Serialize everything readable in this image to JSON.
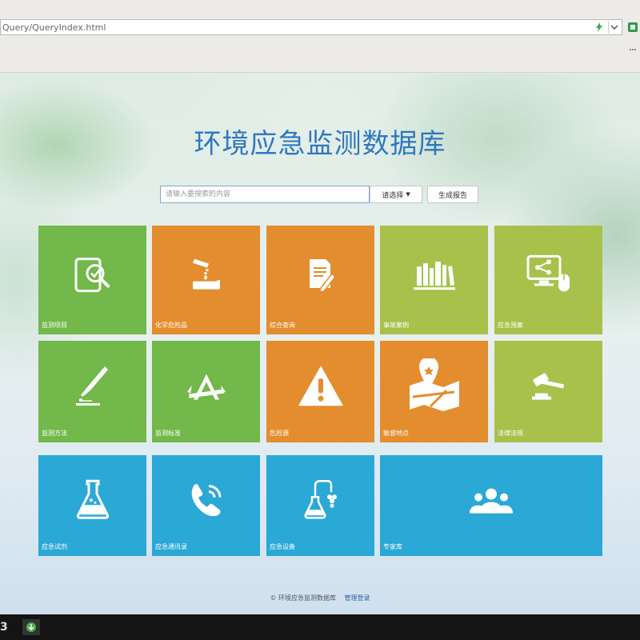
{
  "browser": {
    "url": "Query/QueryIndex.html",
    "icons": [
      "lightning-icon",
      "dropdown-icon",
      "extension-icon"
    ]
  },
  "page": {
    "title": "环境应急监测数据库",
    "search": {
      "placeholder": "请输入要搜索的内容",
      "select_label": "请选择",
      "report_label": "生成报告"
    },
    "tiles": [
      {
        "label": "监测项目",
        "color": "#72b84a",
        "icon": "tablet-search-icon"
      },
      {
        "label": "化学危险品",
        "color": "#e38d2e",
        "icon": "chemical-pour-icon"
      },
      {
        "label": "综合查询",
        "color": "#e38d2e",
        "icon": "document-pen-icon"
      },
      {
        "label": "事故案例",
        "color": "#a7c14b",
        "icon": "books-icon"
      },
      {
        "label": "应急预案",
        "color": "#a7c14b",
        "icon": "computer-network-icon"
      },
      {
        "label": "监测方法",
        "color": "#72b84a",
        "icon": "pipette-icon"
      },
      {
        "label": "监测标准",
        "color": "#72b84a",
        "icon": "compass-ruler-icon"
      },
      {
        "label": "危险源",
        "color": "#e38d2e",
        "icon": "warning-icon"
      },
      {
        "label": "敏感地点",
        "color": "#e38d2e",
        "icon": "map-pin-icon"
      },
      {
        "label": "法律法规",
        "color": "#a7c14b",
        "icon": "gavel-icon"
      },
      {
        "label": "应急试剂",
        "color": "#2aa8d6",
        "icon": "flask-icon"
      },
      {
        "label": "应急通讯录",
        "color": "#2aa8d6",
        "icon": "phone-icon"
      },
      {
        "label": "应急设备",
        "color": "#2aa8d6",
        "icon": "lab-equipment-icon"
      },
      {
        "label": "专家库",
        "color": "#2aa8d6",
        "icon": "people-group-icon"
      }
    ],
    "footer": {
      "copyright": "© 环境应急监测数据库",
      "admin_link": "管理登录"
    }
  },
  "taskbar": {
    "glyph": "3"
  }
}
